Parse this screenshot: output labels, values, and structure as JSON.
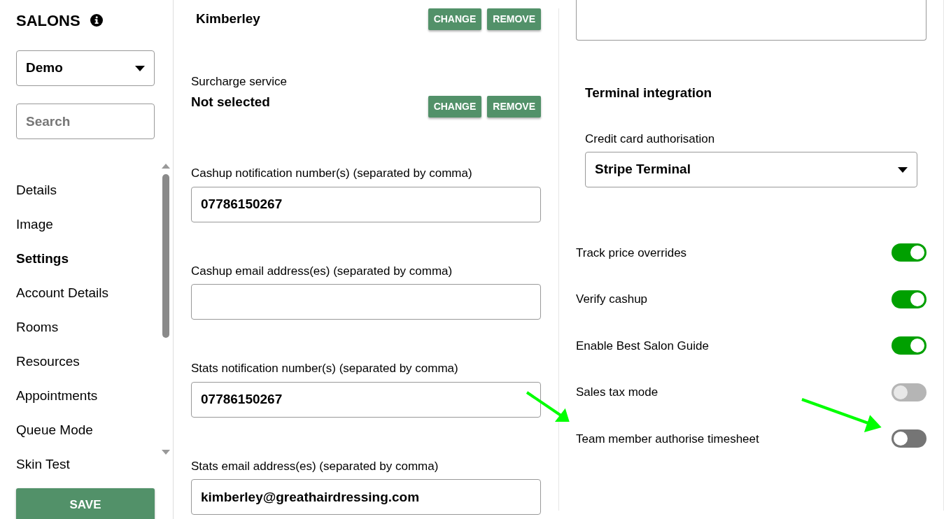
{
  "sidebar": {
    "title": "SALONS",
    "salon_select": {
      "value": "Demo"
    },
    "search": {
      "placeholder": "Search"
    },
    "items": [
      {
        "label": "Details",
        "selected": false
      },
      {
        "label": "Image",
        "selected": false
      },
      {
        "label": "Settings",
        "selected": true
      },
      {
        "label": "Account Details",
        "selected": false
      },
      {
        "label": "Rooms",
        "selected": false
      },
      {
        "label": "Resources",
        "selected": false
      },
      {
        "label": "Appointments",
        "selected": false
      },
      {
        "label": "Queue Mode",
        "selected": false
      },
      {
        "label": "Skin Test",
        "selected": false
      }
    ],
    "save_button": "SAVE"
  },
  "staff": {
    "value": "Kimberley",
    "buttons": [
      "CHANGE",
      "REMOVE"
    ]
  },
  "surcharge": {
    "label": "Surcharge service",
    "value": "Not selected",
    "buttons": [
      "CHANGE",
      "REMOVE"
    ]
  },
  "fields": [
    {
      "label": "Cashup notification number(s) (separated by comma)",
      "value": "07786150267"
    },
    {
      "label": "Cashup email address(es) (separated by comma)"
    },
    {
      "label": "Stats notification number(s) (separated by comma)",
      "value": "07786150267"
    },
    {
      "label": "Stats email address(es) (separated by comma)",
      "value": "kimberley@greathairdressing.com"
    }
  ],
  "terminal": {
    "heading": "Terminal integration",
    "label": "Credit card authorisation",
    "value": "Stripe Terminal"
  },
  "toggles": [
    {
      "label": "Track price overrides",
      "on": true,
      "disabled": false
    },
    {
      "label": "Verify cashup",
      "on": true,
      "disabled": false
    },
    {
      "label": "Enable Best Salon Guide",
      "on": true,
      "disabled": false
    },
    {
      "label": "Sales tax mode",
      "on": false,
      "disabled": true
    },
    {
      "label": "Team member authorise timesheet",
      "on": false,
      "disabled": false
    }
  ]
}
